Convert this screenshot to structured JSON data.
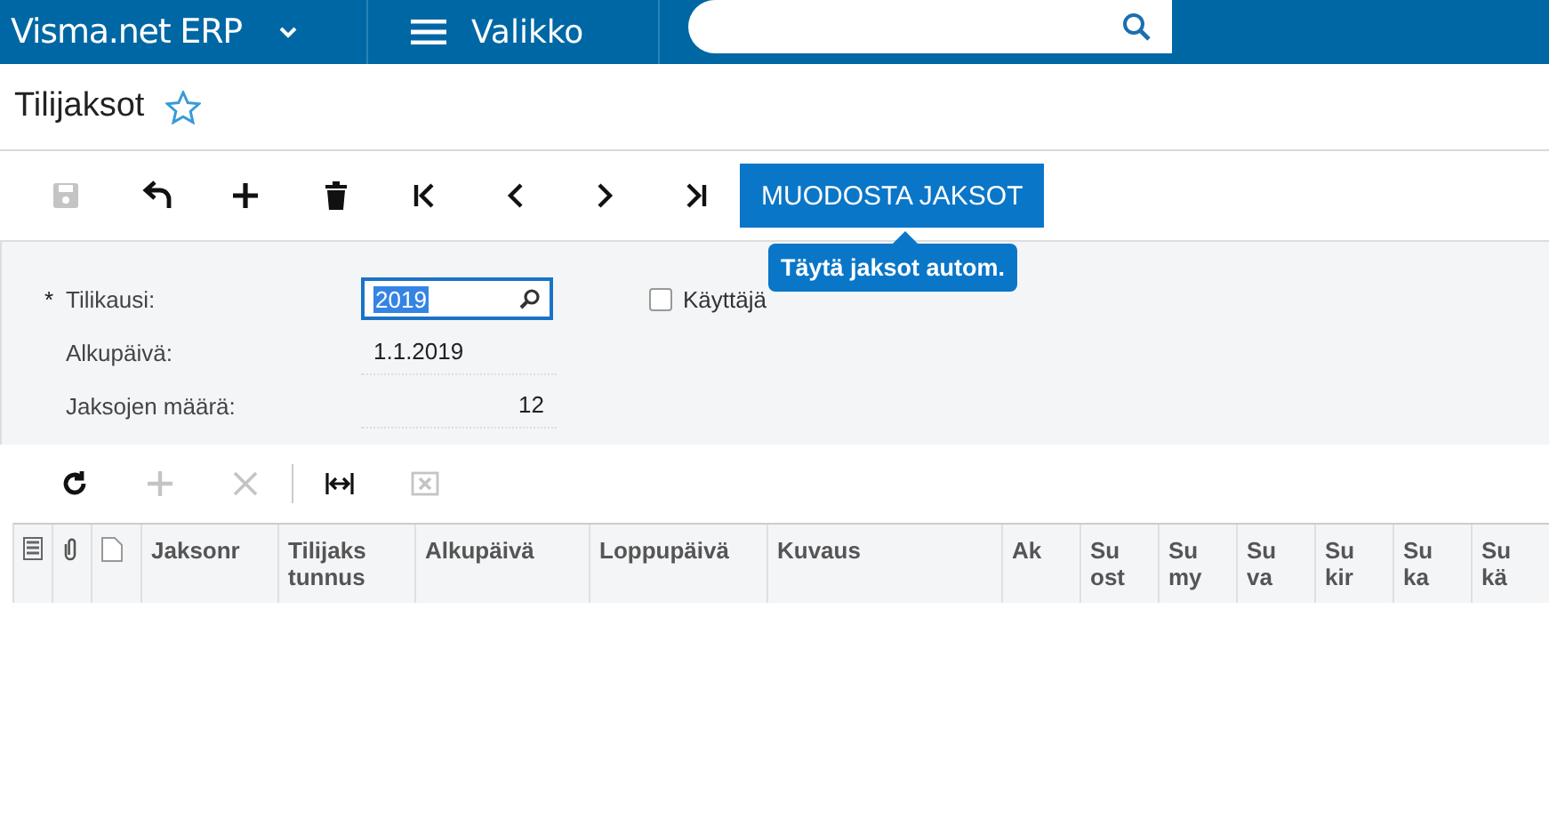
{
  "topbar": {
    "product": "Visma.net ERP",
    "menu": "Valikko"
  },
  "page": {
    "title": "Tilijaksot",
    "favorite": false
  },
  "toolbar": {
    "icons": [
      {
        "kind": "save",
        "disabled": true
      },
      {
        "kind": "undo",
        "disabled": false
      },
      {
        "kind": "add",
        "disabled": false
      },
      {
        "kind": "delete",
        "disabled": false
      },
      {
        "kind": "first",
        "disabled": false
      },
      {
        "kind": "prev",
        "disabled": false
      },
      {
        "kind": "next",
        "disabled": false
      },
      {
        "kind": "last",
        "disabled": false
      }
    ],
    "action": "MUODOSTA JAKSOT",
    "tooltip": "Täytä jaksot autom."
  },
  "form": {
    "required_mark": "*",
    "fields": [
      {
        "label": "Tilikausi:",
        "required": true,
        "kind": "lookup",
        "value": "2019"
      },
      {
        "label": "Alkupäivä:",
        "required": false,
        "kind": "text",
        "value": "1.1.2019"
      },
      {
        "label": "Jaksojen määrä:",
        "required": false,
        "kind": "number",
        "value": "12"
      }
    ],
    "checkbox": {
      "label": "Käyttäjä",
      "checked": false
    }
  },
  "grid": {
    "tools": [
      {
        "kind": "refresh",
        "disabled": false
      },
      {
        "kind": "add",
        "disabled": true
      },
      {
        "kind": "remove",
        "disabled": true
      },
      {
        "kind": "fit",
        "disabled": false
      },
      {
        "kind": "excel",
        "disabled": true
      }
    ],
    "columns": [
      "Jaksonr",
      "Tilijaks tunnus",
      "Alkupäivä",
      "Loppupäivä",
      "Kuvaus",
      "Ak",
      "Su ost",
      "Su my",
      "Su va",
      "Su kir",
      "Su ka",
      "Su kä"
    ]
  }
}
